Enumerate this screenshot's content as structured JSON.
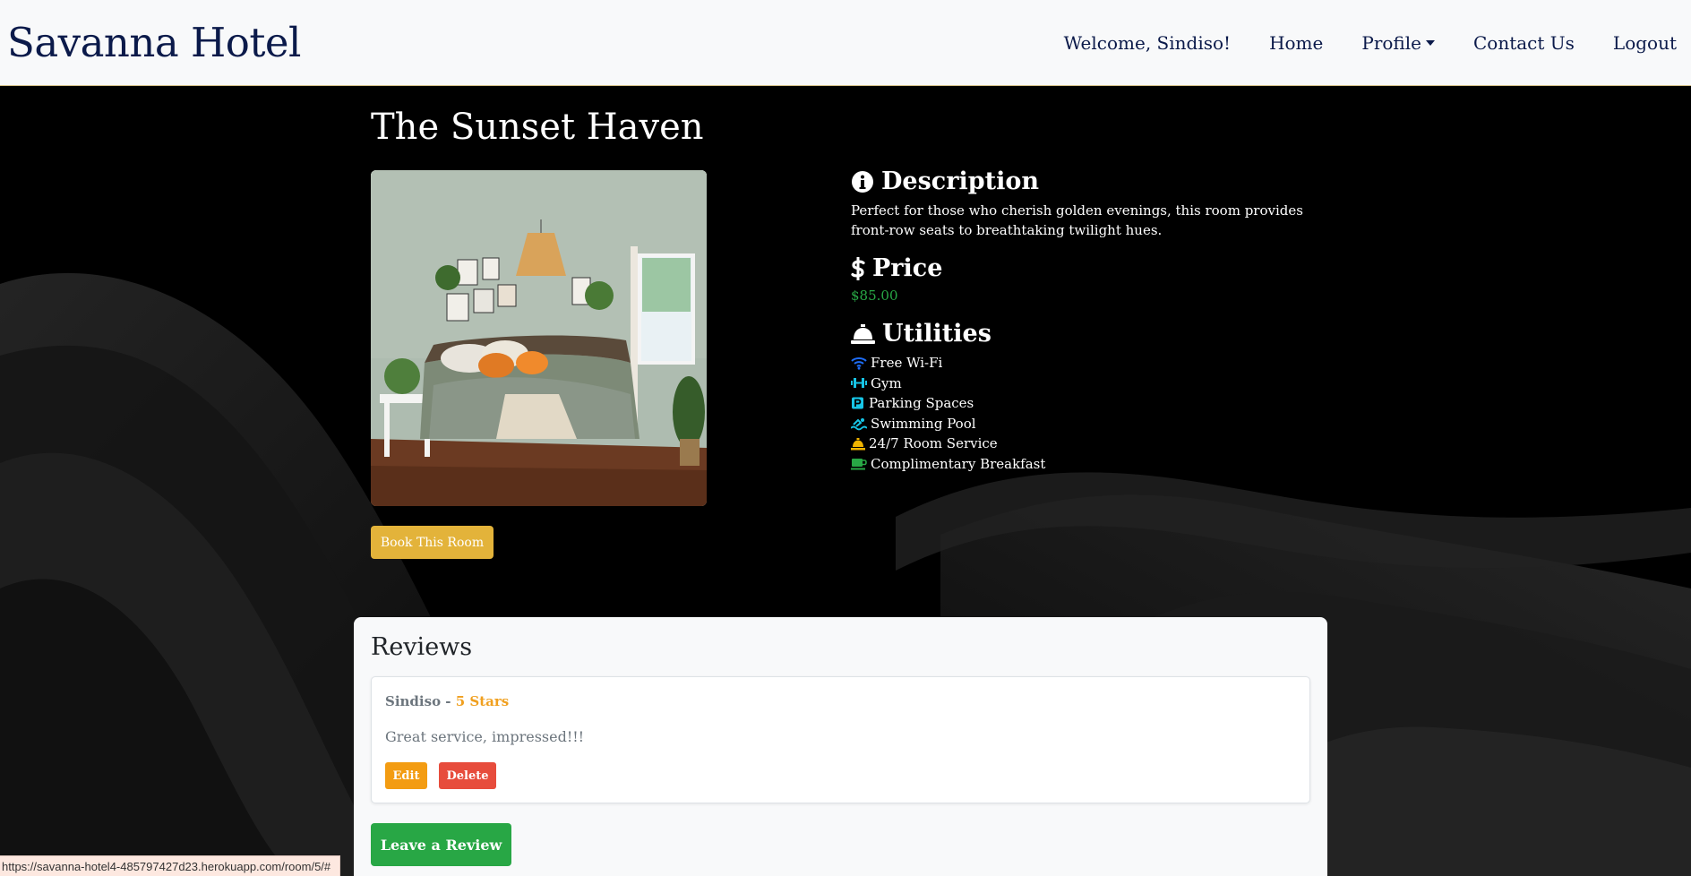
{
  "navbar": {
    "brand": "Savanna Hotel",
    "welcome": "Welcome, Sindiso!",
    "home": "Home",
    "profile": "Profile",
    "contact": "Contact Us",
    "logout": "Logout"
  },
  "room": {
    "title": "The Sunset Haven",
    "book_label": "Book This Room",
    "description_heading": "Description",
    "description": "Perfect for those who cherish golden evenings, this room provides front-row seats to breathtaking twilight hues.",
    "price_heading": "Price",
    "price": "$85.00",
    "utilities_heading": "Utilities",
    "utilities": [
      {
        "label": "Free Wi-Fi",
        "icon": "wifi-icon",
        "color": "#1e6cf5"
      },
      {
        "label": "Gym",
        "icon": "dumbbell-icon",
        "color": "#17c5e6"
      },
      {
        "label": "Parking Spaces",
        "icon": "parking-icon",
        "color": "#17c5e6"
      },
      {
        "label": "Swimming Pool",
        "icon": "swimmer-icon",
        "color": "#17c5e6"
      },
      {
        "label": "24/7 Room Service",
        "icon": "bell-icon",
        "color": "#f0b400"
      },
      {
        "label": "Complimentary Breakfast",
        "icon": "coffee-icon",
        "color": "#28a745"
      }
    ]
  },
  "reviews": {
    "title": "Reviews",
    "items": [
      {
        "author": "Sindiso",
        "separator": " - ",
        "stars": "5 Stars",
        "text": "Great service, impressed!!!",
        "edit_label": "Edit",
        "delete_label": "Delete"
      }
    ],
    "leave_label": "Leave a Review"
  },
  "status_url": "https://savanna-hotel4-485797427d23.herokuapp.com/room/5/#",
  "colors": {
    "brand": "#0b1a4a",
    "book_button": "#e3b33a",
    "price": "#28a745",
    "stars": "#f0a020",
    "edit_button": "#f39c12",
    "delete_button": "#e74c3c",
    "leave_button": "#28a745"
  }
}
